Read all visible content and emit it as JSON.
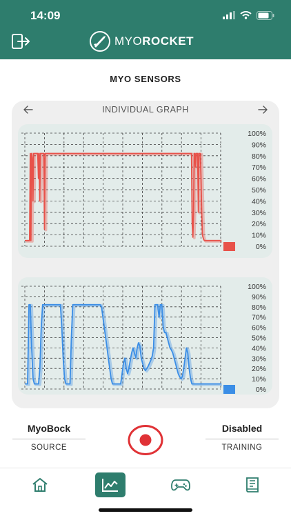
{
  "status": {
    "time": "14:09"
  },
  "app": {
    "logo_light": "MYO",
    "logo_bold": "ROCKET"
  },
  "page": {
    "title": "MYO SENSORS"
  },
  "graph": {
    "title": "INDIVIDUAL GRAPH",
    "percent_labels": [
      "100%",
      "90%",
      "80%",
      "70%",
      "60%",
      "50%",
      "40%",
      "30%",
      "20%",
      "10%",
      "0%"
    ]
  },
  "chart_data": [
    {
      "type": "line",
      "ylim": [
        0,
        100
      ],
      "grid": true,
      "color": "#e8524a",
      "series": [
        {
          "values": [
            5,
            5,
            5,
            5,
            5,
            5,
            5,
            5,
            82,
            5,
            82,
            78,
            40,
            82,
            82,
            82,
            82,
            82,
            82,
            82,
            60,
            82,
            40,
            82,
            82,
            82,
            82,
            82,
            82,
            15,
            82,
            82,
            82,
            82,
            82,
            82,
            82,
            82,
            82,
            82,
            82,
            82,
            82,
            82,
            82,
            82,
            82,
            82,
            82,
            82,
            82,
            82,
            82,
            82,
            82,
            82,
            82,
            82,
            82,
            82,
            82,
            82,
            82,
            82,
            82,
            82,
            82,
            82,
            82,
            82,
            82,
            82,
            82,
            82,
            82,
            82,
            82,
            82,
            82,
            82,
            82,
            82,
            82,
            82,
            82,
            82,
            82,
            82,
            82,
            82,
            82,
            82,
            82,
            82,
            82,
            82,
            82,
            82,
            82,
            82,
            82,
            82,
            82,
            82,
            82,
            82,
            82,
            82,
            82,
            82,
            82,
            82,
            82,
            82,
            82,
            82,
            82,
            82,
            82,
            82,
            82,
            82,
            82,
            82,
            82,
            82,
            82,
            82,
            82,
            82,
            82,
            82,
            82,
            82,
            82,
            82,
            82,
            82,
            82,
            82,
            82,
            82,
            82,
            82,
            82,
            82,
            82,
            82,
            82,
            82,
            82,
            82,
            82,
            82,
            82,
            82,
            82,
            82,
            82,
            82,
            82,
            82,
            82,
            82,
            82,
            82,
            82,
            82,
            82,
            82,
            82,
            82,
            82,
            82,
            82,
            82,
            82,
            82,
            82,
            82,
            82,
            82,
            82,
            82,
            82,
            82,
            82,
            82,
            82,
            82,
            82,
            82,
            82,
            82,
            82,
            82,
            82,
            82,
            82,
            82,
            82,
            82,
            82,
            82,
            82,
            82,
            82,
            82,
            82,
            82,
            82,
            82,
            82,
            82,
            82,
            82,
            82,
            82,
            82,
            82,
            82,
            82,
            82,
            82,
            82,
            82,
            82,
            82,
            82,
            82,
            82,
            82,
            82,
            82,
            82,
            82,
            82,
            82,
            82,
            82,
            82,
            82,
            82,
            82,
            82,
            82,
            82,
            20,
            8,
            30,
            82,
            82,
            70,
            82,
            82,
            82,
            30,
            82,
            82,
            82,
            60,
            30,
            10,
            8,
            6,
            5,
            5,
            5,
            5,
            5,
            5,
            5,
            5,
            5,
            5,
            5,
            5,
            5,
            5,
            5,
            5,
            5,
            5,
            5,
            5,
            5,
            5,
            5,
            5,
            5
          ]
        }
      ]
    },
    {
      "type": "line",
      "ylim": [
        0,
        100
      ],
      "grid": true,
      "color": "#3b8ee6",
      "series": [
        {
          "values": [
            5,
            5,
            5,
            82,
            82,
            40,
            10,
            5,
            5,
            5,
            5,
            20,
            60,
            82,
            82,
            82,
            82,
            82,
            82,
            82,
            82,
            82,
            82,
            82,
            82,
            82,
            82,
            60,
            30,
            10,
            5,
            5,
            5,
            5,
            50,
            82,
            82,
            82,
            82,
            82,
            82,
            82,
            82,
            82,
            82,
            82,
            82,
            82,
            82,
            82,
            82,
            82,
            82,
            82,
            82,
            82,
            80,
            70,
            60,
            50,
            40,
            30,
            20,
            10,
            5,
            5,
            5,
            5,
            5,
            5,
            5,
            15,
            25,
            30,
            20,
            15,
            20,
            28,
            35,
            40,
            35,
            30,
            40,
            45,
            42,
            30,
            25,
            20,
            18,
            20,
            22,
            25,
            28,
            32,
            40,
            82,
            82,
            82,
            70,
            82,
            82,
            60,
            55,
            55,
            50,
            45,
            40,
            38,
            35,
            30,
            25,
            20,
            15,
            12,
            10,
            12,
            20,
            30,
            40,
            35,
            20,
            10,
            5,
            5,
            5,
            5,
            5,
            5,
            5,
            5,
            5,
            5,
            5,
            5,
            5,
            5,
            5,
            5,
            5,
            5,
            5,
            5,
            5,
            5
          ]
        }
      ]
    }
  ],
  "source": {
    "value": "MyoBock",
    "label": "SOURCE"
  },
  "training": {
    "value": "Disabled",
    "label": "TRAINING"
  },
  "colors": {
    "accent": "#2e7d6d",
    "record": "#e03236",
    "red_series": "#e8524a",
    "blue_series": "#3b8ee6"
  },
  "nav": {
    "items": [
      "home-icon",
      "chart-icon",
      "gamepad-icon",
      "book-icon"
    ],
    "active": "chart-icon"
  }
}
